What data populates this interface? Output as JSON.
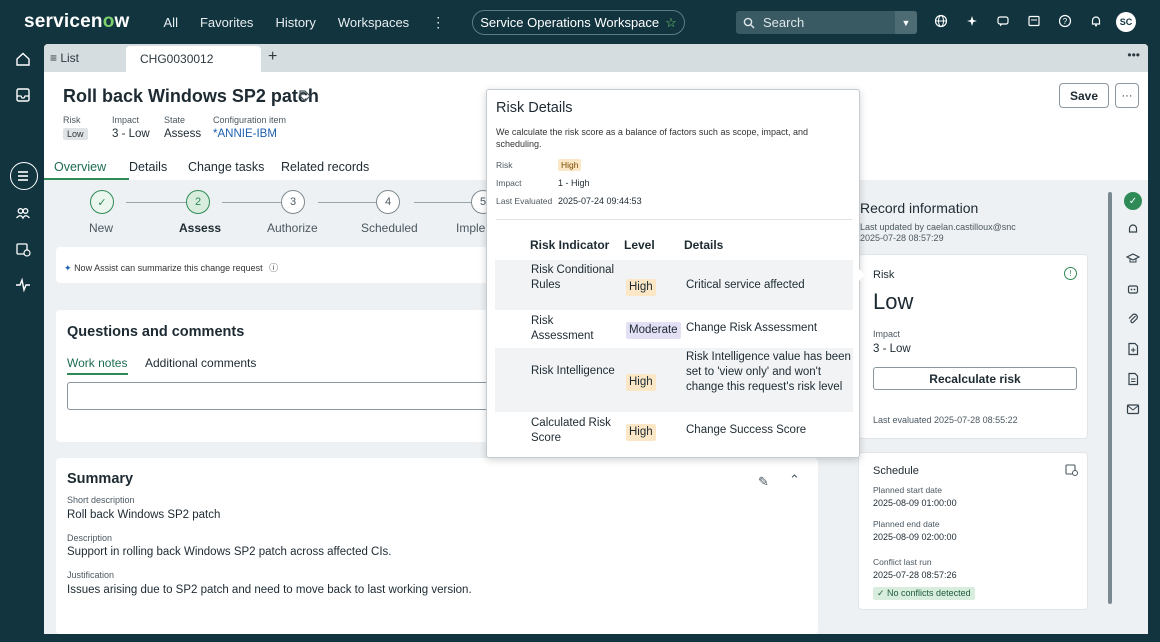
{
  "topbar": {
    "logo": "servicenow",
    "nav": [
      "All",
      "Favorites",
      "History",
      "Workspaces"
    ],
    "workspace_name": "Service Operations Workspace",
    "search_placeholder": "Search",
    "avatar_initials": "SC"
  },
  "tabs": {
    "list_label": "List",
    "record_tab": "CHG0030012"
  },
  "record": {
    "title": "Roll back Windows SP2 patch",
    "fields": [
      {
        "label": "Risk",
        "value": "Low"
      },
      {
        "label": "Impact",
        "value": "3 - Low"
      },
      {
        "label": "State",
        "value": "Assess"
      },
      {
        "label": "Configuration item",
        "value": "*ANNIE-IBM"
      }
    ],
    "save_label": "Save",
    "more_label": "···"
  },
  "record_tabs": [
    "Overview",
    "Details",
    "Change tasks",
    "Related records"
  ],
  "stepper": [
    {
      "n": "✓",
      "label": "New",
      "status": "done"
    },
    {
      "n": "2",
      "label": "Assess",
      "status": "current"
    },
    {
      "n": "3",
      "label": "Authorize",
      "status": "pending"
    },
    {
      "n": "4",
      "label": "Scheduled",
      "status": "pending"
    },
    {
      "n": "5",
      "label": "Imple",
      "status": "pending"
    }
  ],
  "assist_text": "Now Assist can summarize this change request",
  "questions": {
    "title": "Questions and comments",
    "tabs": [
      "Work notes",
      "Additional comments"
    ]
  },
  "summary": {
    "title": "Summary",
    "fields": [
      {
        "label": "Short description",
        "value": "Roll back Windows SP2 patch"
      },
      {
        "label": "Description",
        "value": "Support in rolling back Windows SP2 patch across affected CIs."
      },
      {
        "label": "Justification",
        "value": "Issues arising due to SP2 patch and need to move back to last working version."
      }
    ]
  },
  "record_info": {
    "title": "Record information",
    "updated_by": "Last updated by caelan.castilloux@snc",
    "updated_at": "2025-07-28 08:57:29",
    "risk_card": {
      "label": "Risk",
      "value": "Low",
      "impact_label": "Impact",
      "impact_value": "3 - Low",
      "button": "Recalculate risk",
      "last_evaluated": "Last evaluated 2025-07-28 08:55:22"
    },
    "schedule": {
      "title": "Schedule",
      "items": [
        {
          "label": "Planned start date",
          "value": "2025-08-09 01:00:00"
        },
        {
          "label": "Planned end date",
          "value": "2025-08-09 02:00:00"
        },
        {
          "label": "Conflict last run",
          "value": "2025-07-28 08:57:26"
        }
      ],
      "badge": "✓ No conflicts detected"
    }
  },
  "popover": {
    "title": "Risk Details",
    "description": "We calculate the risk score as a balance of factors such as scope, impact, and scheduling.",
    "summary": [
      {
        "label": "Risk",
        "value": "High",
        "badge": true
      },
      {
        "label": "Impact",
        "value": "1 - High",
        "badge": false
      },
      {
        "label": "Last Evaluated",
        "value": "2025-07-24 09:44:53",
        "badge": false
      }
    ],
    "headers": [
      "Risk Indicator",
      "Level",
      "Details"
    ],
    "rows": [
      {
        "indicator": "Risk Conditional Rules",
        "level": "High",
        "details": "Critical service affected"
      },
      {
        "indicator": "Risk Assessment",
        "level": "Moderate",
        "details": "Change Risk Assessment"
      },
      {
        "indicator": "Risk Intelligence",
        "level": "High",
        "details": "Risk Intelligence value has been set to 'view only' and won't change this request's risk level"
      },
      {
        "indicator": "Calculated Risk Score",
        "level": "High",
        "details": "Change Success Score"
      }
    ]
  },
  "colors": {
    "nav_bg": "#11343f",
    "accent_green": "#2e8b57",
    "high_badge": "#fbe7c6",
    "moderate_badge": "#e3e0f5"
  }
}
